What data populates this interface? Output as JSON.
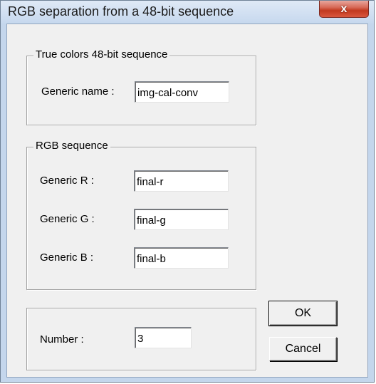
{
  "window": {
    "title": "RGB separation from a 48-bit sequence",
    "close_symbol": "x"
  },
  "true_colors_group": {
    "legend": "True colors 48-bit sequence",
    "generic_name_label": "Generic name :",
    "generic_name_value": "img-cal-conv"
  },
  "rgb_group": {
    "legend": "RGB sequence",
    "r_label": "Generic R :",
    "r_value": "final-r",
    "g_label": "Generic G :",
    "g_value": "final-g",
    "b_label": "Generic B :",
    "b_value": "final-b"
  },
  "number_group": {
    "label": "Number :",
    "value": "3"
  },
  "buttons": {
    "ok": "OK",
    "cancel": "Cancel"
  },
  "colors": {
    "frame": "#c4d6ec",
    "client": "#f0f0f0",
    "close_button": "#c2391f"
  }
}
